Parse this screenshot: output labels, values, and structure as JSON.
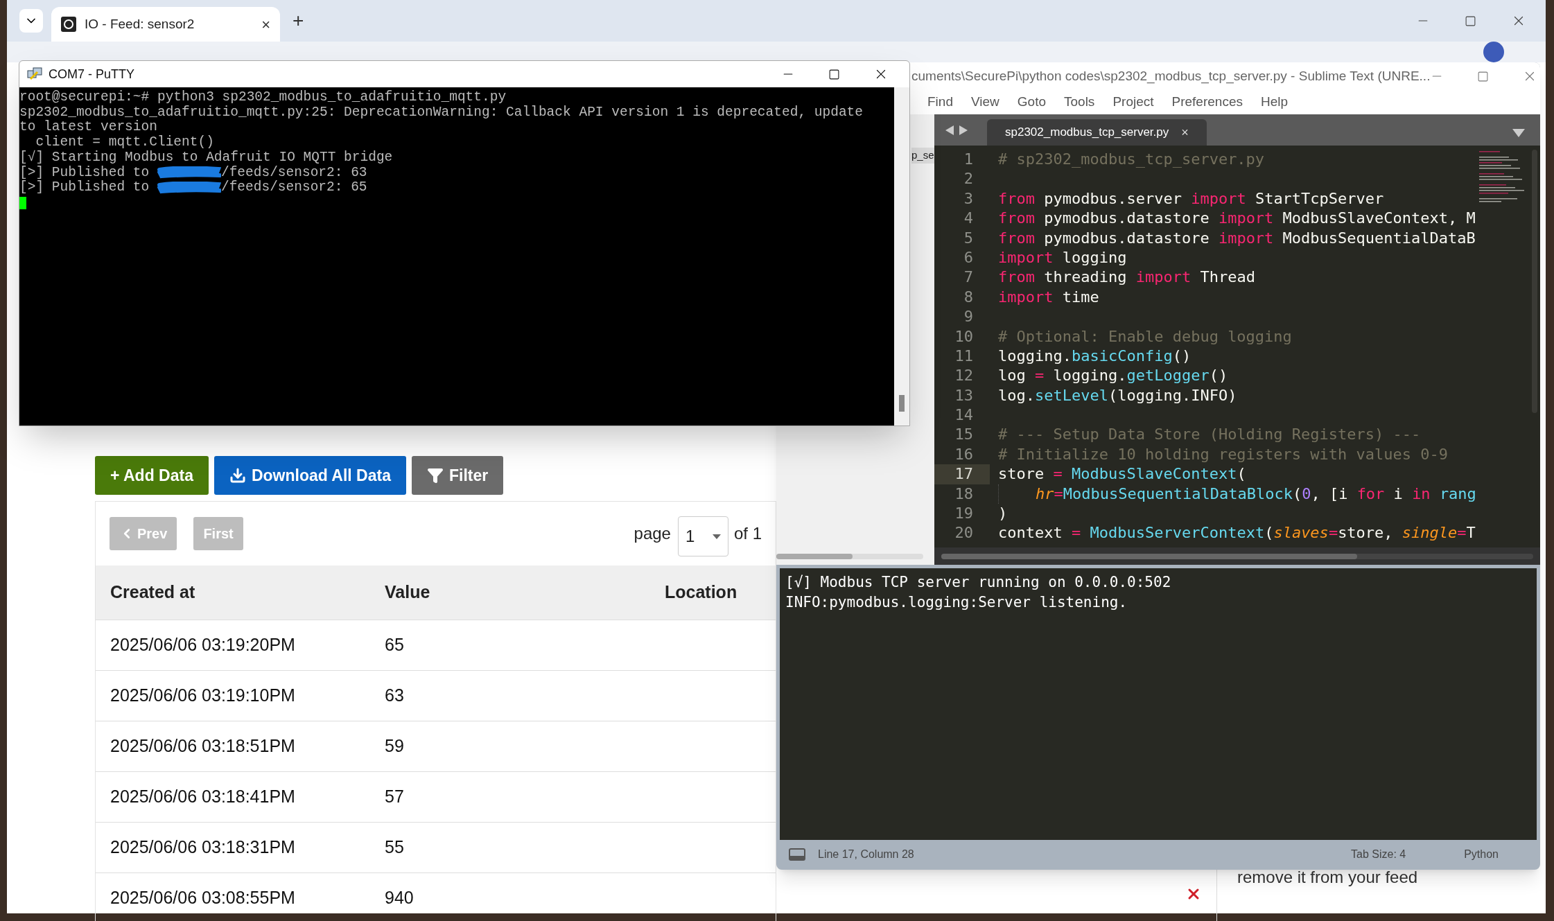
{
  "browser": {
    "tab_title": "IO - Feed: sensor2",
    "tab_close": "×",
    "new_tab": "+"
  },
  "feed_page": {
    "actions": [
      {
        "label": "+ Add Data",
        "kind": "add"
      },
      {
        "label": "Download All Data",
        "kind": "download"
      },
      {
        "label": "Filter",
        "kind": "filter"
      }
    ],
    "pagination": {
      "buttons": [
        {
          "label": "Prev",
          "kind": "prev",
          "disabled": true
        },
        {
          "label": "First",
          "kind": "first",
          "disabled": true
        }
      ],
      "page_label": "page",
      "page_value": "1",
      "of_label": "of 1"
    },
    "table": {
      "columns": [
        "Created at",
        "Value",
        "Location"
      ],
      "rows": [
        [
          "2025/06/06 03:19:20PM",
          "65"
        ],
        [
          "2025/06/06 03:19:10PM",
          "63"
        ],
        [
          "2025/06/06 03:18:51PM",
          "59"
        ],
        [
          "2025/06/06 03:18:41PM",
          "57"
        ],
        [
          "2025/06/06 03:18:31PM",
          "55"
        ],
        [
          "2025/06/06 03:08:55PM",
          "940"
        ]
      ]
    },
    "side_note": "remove it from your feed"
  },
  "putty": {
    "title": "COM7 - PuTTY",
    "lines": [
      {
        "kind": "text",
        "text": "root@securepi:~# python3 sp2302_modbus_to_adafruitio_mqtt.py"
      },
      {
        "kind": "text",
        "text": "sp2302_modbus_to_adafruitio_mqtt.py:25: DeprecationWarning: Callback API version 1 is deprecated, update"
      },
      {
        "kind": "text",
        "text": "to latest version"
      },
      {
        "kind": "text",
        "text": "  client = mqtt.Client()"
      },
      {
        "kind": "text",
        "text": "[√] Starting Modbus to Adafruit IO MQTT bridge"
      },
      {
        "kind": "redacted",
        "before": "[>] Published to ",
        "after": "/feeds/sensor2: 63"
      },
      {
        "kind": "redacted",
        "before": "[>] Published to ",
        "after": "/feeds/sensor2: 65"
      }
    ]
  },
  "sublime": {
    "title": "cuments\\SecurePi\\python codes\\sp2302_modbus_tcp_server.py - Sublime Text (UNRE...",
    "menu": [
      "Find",
      "View",
      "Goto",
      "Tools",
      "Project",
      "Preferences",
      "Help"
    ],
    "sidebar_fragment": "p_se",
    "tab": {
      "label": "sp2302_modbus_tcp_server.py",
      "close": "×"
    },
    "code": [
      {
        "number": "1",
        "current": false,
        "tokens": [
          {
            "kind": "comment",
            "text": "# sp2302_modbus_tcp_server.py"
          }
        ]
      },
      {
        "number": "2",
        "current": false
      },
      {
        "number": "3",
        "current": false,
        "tokens": [
          {
            "kind": "keyword",
            "text": "from"
          },
          {
            "kind": "plain",
            "text": " pymodbus.server "
          },
          {
            "kind": "keyword",
            "text": "import"
          },
          {
            "kind": "plain",
            "text": " StartTcpServer"
          }
        ]
      },
      {
        "number": "4",
        "current": false,
        "tokens": [
          {
            "kind": "keyword",
            "text": "from"
          },
          {
            "kind": "plain",
            "text": " pymodbus.datastore "
          },
          {
            "kind": "keyword",
            "text": "import"
          },
          {
            "kind": "plain",
            "text": " ModbusSlaveContext, M"
          }
        ]
      },
      {
        "number": "5",
        "current": false,
        "tokens": [
          {
            "kind": "keyword",
            "text": "from"
          },
          {
            "kind": "plain",
            "text": " pymodbus.datastore "
          },
          {
            "kind": "keyword",
            "text": "import"
          },
          {
            "kind": "plain",
            "text": " ModbusSequentialDataB"
          }
        ]
      },
      {
        "number": "6",
        "current": false,
        "tokens": [
          {
            "kind": "keyword",
            "text": "import"
          },
          {
            "kind": "plain",
            "text": " logging"
          }
        ]
      },
      {
        "number": "7",
        "current": false,
        "tokens": [
          {
            "kind": "keyword",
            "text": "from"
          },
          {
            "kind": "plain",
            "text": " threading "
          },
          {
            "kind": "keyword",
            "text": "import"
          },
          {
            "kind": "plain",
            "text": " Thread"
          }
        ]
      },
      {
        "number": "8",
        "current": false,
        "tokens": [
          {
            "kind": "keyword",
            "text": "import"
          },
          {
            "kind": "plain",
            "text": " time"
          }
        ]
      },
      {
        "number": "9",
        "current": false
      },
      {
        "number": "10",
        "current": false,
        "tokens": [
          {
            "kind": "comment",
            "text": "# Optional: Enable debug logging"
          }
        ]
      },
      {
        "number": "11",
        "current": false,
        "tokens": [
          {
            "kind": "plain",
            "text": "logging."
          },
          {
            "kind": "function",
            "text": "basicConfig"
          },
          {
            "kind": "plain",
            "text": "()"
          }
        ]
      },
      {
        "number": "12",
        "current": false,
        "tokens": [
          {
            "kind": "plain",
            "text": "log "
          },
          {
            "kind": "keyword",
            "text": "="
          },
          {
            "kind": "plain",
            "text": " logging."
          },
          {
            "kind": "function",
            "text": "getLogger"
          },
          {
            "kind": "plain",
            "text": "()"
          }
        ]
      },
      {
        "number": "13",
        "current": false,
        "tokens": [
          {
            "kind": "plain",
            "text": "log."
          },
          {
            "kind": "function",
            "text": "setLevel"
          },
          {
            "kind": "plain",
            "text": "(logging.INFO)"
          }
        ]
      },
      {
        "number": "14",
        "current": false
      },
      {
        "number": "15",
        "current": false,
        "tokens": [
          {
            "kind": "comment",
            "text": "# --- Setup Data Store (Holding Registers) ---"
          }
        ]
      },
      {
        "number": "16",
        "current": false,
        "tokens": [
          {
            "kind": "comment",
            "text": "# Initialize 10 holding registers with values 0-9"
          }
        ]
      },
      {
        "number": "17",
        "current": true,
        "tokens": [
          {
            "kind": "plain",
            "text": "store "
          },
          {
            "kind": "keyword",
            "text": "= "
          },
          {
            "kind": "function",
            "text": "ModbusSlaveContext"
          },
          {
            "kind": "plain",
            "text": "("
          }
        ]
      },
      {
        "number": "18",
        "current": false,
        "indented": true,
        "tokens": [
          {
            "kind": "param",
            "text": "hr"
          },
          {
            "kind": "keyword",
            "text": "="
          },
          {
            "kind": "function",
            "text": "ModbusSequentialDataBlock"
          },
          {
            "kind": "plain",
            "text": "("
          },
          {
            "kind": "number",
            "text": "0"
          },
          {
            "kind": "plain",
            "text": ", [i "
          },
          {
            "kind": "keyword",
            "text": "for"
          },
          {
            "kind": "plain",
            "text": " i "
          },
          {
            "kind": "keyword",
            "text": "in "
          },
          {
            "kind": "function",
            "text": "rang"
          }
        ]
      },
      {
        "number": "19",
        "current": false,
        "tokens": [
          {
            "kind": "plain",
            "text": ")"
          }
        ]
      },
      {
        "number": "20",
        "current": false,
        "tokens": [
          {
            "kind": "plain",
            "text": "context "
          },
          {
            "kind": "keyword",
            "text": "= "
          },
          {
            "kind": "function",
            "text": "ModbusServerContext"
          },
          {
            "kind": "plain",
            "text": "("
          },
          {
            "kind": "param",
            "text": "slaves"
          },
          {
            "kind": "keyword",
            "text": "="
          },
          {
            "kind": "plain",
            "text": "store, "
          },
          {
            "kind": "param",
            "text": "single"
          },
          {
            "kind": "keyword",
            "text": "="
          },
          {
            "kind": "plain",
            "text": "T"
          }
        ]
      }
    ],
    "console": [
      "[√] Modbus TCP server running on 0.0.0.0:502",
      "INFO:pymodbus.logging:Server listening."
    ],
    "status": {
      "position": "Line 17, Column 28",
      "tab_size": "Tab Size: 4",
      "syntax": "Python"
    }
  }
}
